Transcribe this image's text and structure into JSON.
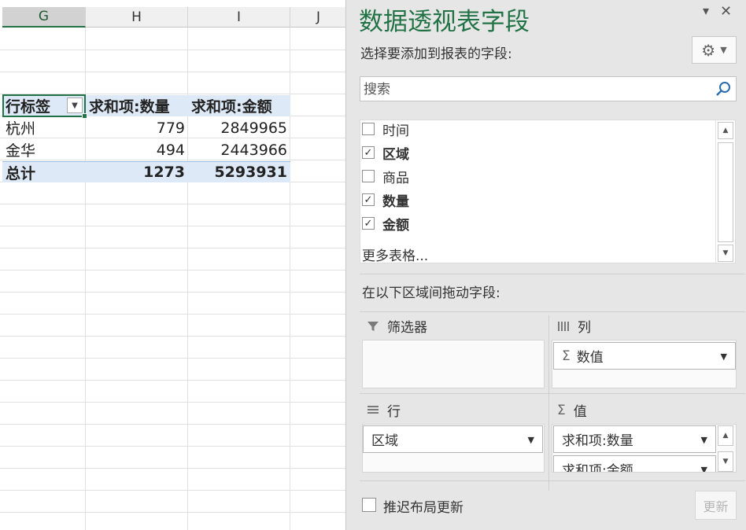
{
  "sheet": {
    "columns": [
      "G",
      "H",
      "I",
      "J"
    ],
    "selected_column": "G",
    "pivot": {
      "header": [
        "行标签",
        "求和项:数量",
        "求和项:金额"
      ],
      "rows": [
        {
          "label": "杭州",
          "qty": "779",
          "amount": "2849965"
        },
        {
          "label": "金华",
          "qty": "494",
          "amount": "2443966"
        }
      ],
      "total": {
        "label": "总计",
        "qty": "1273",
        "amount": "5293931"
      }
    }
  },
  "pane": {
    "title": "数据透视表字段",
    "choose_label": "选择要添加到报表的字段:",
    "search": {
      "placeholder": "搜索"
    },
    "fields": [
      {
        "label": "时间",
        "checked": false
      },
      {
        "label": "区域",
        "checked": true
      },
      {
        "label": "商品",
        "checked": false
      },
      {
        "label": "数量",
        "checked": true
      },
      {
        "label": "金额",
        "checked": true
      }
    ],
    "more_tables": "更多表格...",
    "drag_label": "在以下区域间拖动字段:",
    "areas": {
      "filters": {
        "label": "筛选器",
        "items": []
      },
      "columns": {
        "label": "列",
        "items": [
          "数值"
        ]
      },
      "rows": {
        "label": "行",
        "items": [
          "区域"
        ]
      },
      "values": {
        "label": "值",
        "items": [
          "求和项:数量",
          "求和项:金额"
        ]
      }
    },
    "defer_label": "推迟布局更新",
    "update_label": "更新",
    "accent_color": "#217346"
  }
}
